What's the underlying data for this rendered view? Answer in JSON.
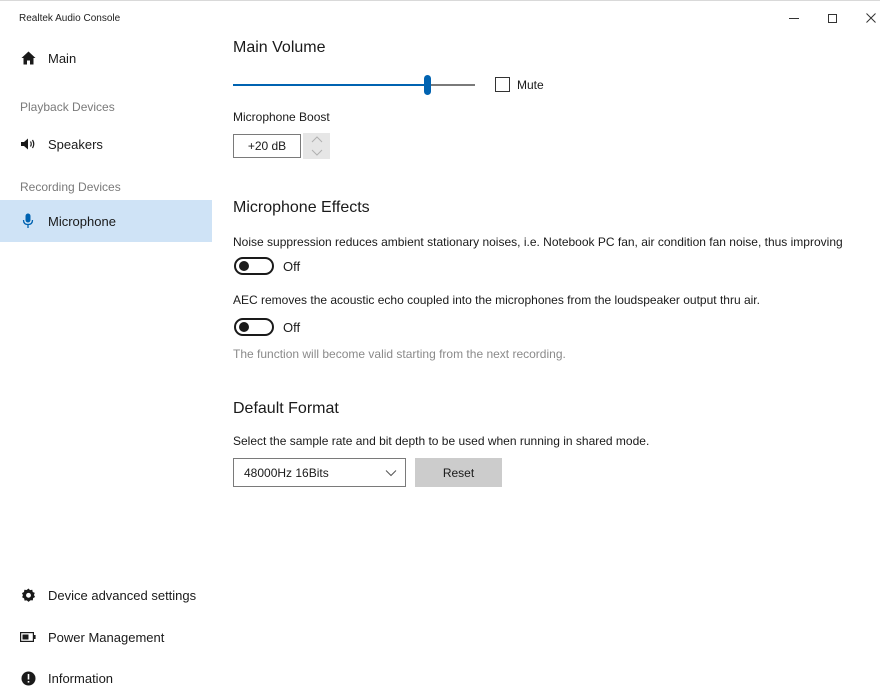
{
  "window": {
    "title": "Realtek Audio Console"
  },
  "sidebar": {
    "main_label": "Main",
    "playback_header": "Playback Devices",
    "speakers_label": "Speakers",
    "recording_header": "Recording Devices",
    "microphone_label": "Microphone",
    "advanced_label": "Device advanced settings",
    "power_label": "Power Management",
    "info_label": "Information"
  },
  "volume": {
    "heading": "Main Volume",
    "level_fraction": 0.8,
    "mute_label": "Mute",
    "mute_checked": false
  },
  "boost": {
    "label": "Microphone Boost",
    "value": "+20 dB"
  },
  "effects": {
    "heading": "Microphone Effects",
    "noise_text": "Noise suppression reduces ambient stationary noises, i.e. Notebook PC fan, air condition fan noise, thus improving",
    "noise_state": "Off",
    "aec_text": "AEC removes the acoustic echo coupled into the microphones from the loudspeaker output thru air.",
    "aec_state": "Off",
    "hint": "The function will become valid starting from the next recording."
  },
  "format": {
    "heading": "Default Format",
    "description": "Select the sample rate and bit depth to be used when running in shared mode.",
    "selected": "48000Hz 16Bits",
    "reset_label": "Reset"
  },
  "colors": {
    "accent": "#0063b1",
    "selected_bg": "#cfe3f6"
  }
}
